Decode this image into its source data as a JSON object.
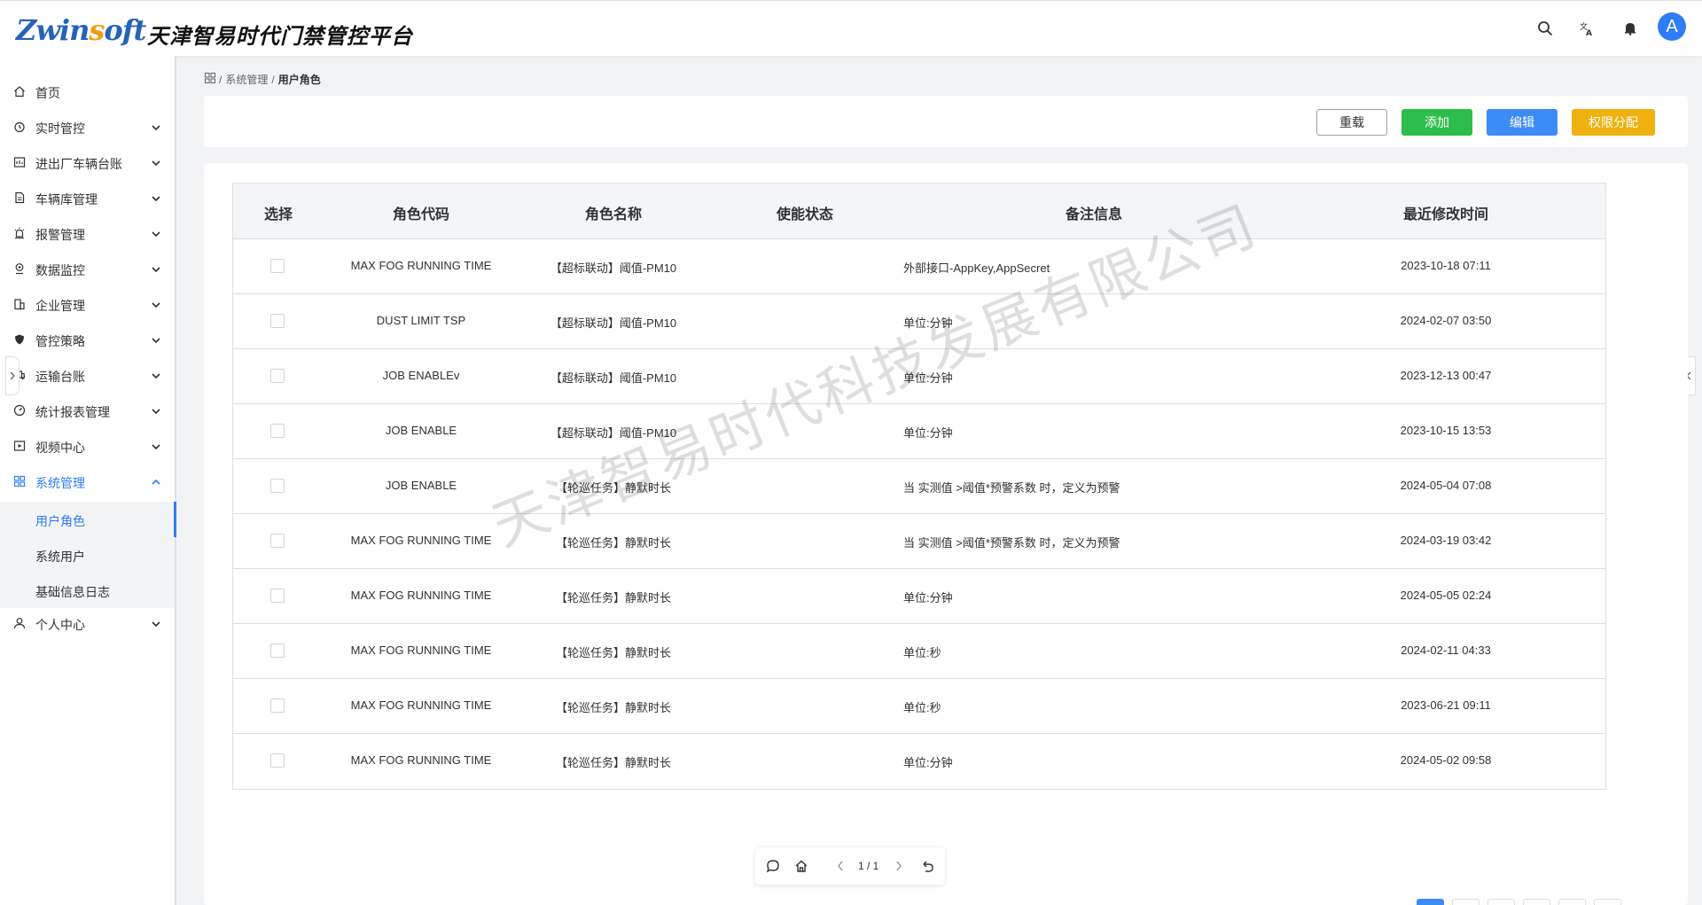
{
  "header": {
    "logo_text": "Zwinsoft",
    "title": "天津智易时代门禁管控平台",
    "avatar_letter": "A",
    "icons": [
      "search-icon",
      "translate-icon",
      "bell-icon"
    ]
  },
  "sidebar": {
    "items": [
      {
        "label": "首页",
        "icon": "home-icon",
        "chevron": false
      },
      {
        "label": "实时管控",
        "icon": "alarm-clock-icon",
        "chevron": true
      },
      {
        "label": "进出厂车辆台账",
        "icon": "ledger-icon",
        "chevron": true
      },
      {
        "label": "车辆库管理",
        "icon": "document-icon",
        "chevron": true
      },
      {
        "label": "报警管理",
        "icon": "siren-icon",
        "chevron": true
      },
      {
        "label": "数据监控",
        "icon": "location-icon",
        "chevron": true
      },
      {
        "label": "企业管理",
        "icon": "building-icon",
        "chevron": true
      },
      {
        "label": "管控策略",
        "icon": "shield-icon",
        "chevron": true
      },
      {
        "label": "运输台账",
        "icon": "truck-icon",
        "chevron": true
      },
      {
        "label": "统计报表管理",
        "icon": "dashboard-icon",
        "chevron": true
      },
      {
        "label": "视频中心",
        "icon": "video-icon",
        "chevron": true
      },
      {
        "label": "系统管理",
        "icon": "grid-icon",
        "chevron": true,
        "expanded": true
      },
      {
        "label": "个人中心",
        "icon": "user-icon",
        "chevron": true
      }
    ],
    "submenu": [
      {
        "label": "用户角色",
        "active": true
      },
      {
        "label": "系统用户",
        "active": false
      },
      {
        "label": "基础信息日志",
        "active": false
      }
    ]
  },
  "breadcrumb": {
    "parent": "系统管理",
    "current": "用户角色"
  },
  "toolbar": {
    "reset_label": "重载",
    "add_label": "添加",
    "edit_label": "编辑",
    "perm_label": "权限分配"
  },
  "table": {
    "headers": [
      "选择",
      "角色代码",
      "角色名称",
      "使能状态",
      "备注信息",
      "最近修改时间"
    ],
    "rows": [
      {
        "code": "MAX FOG RUNNING TIME",
        "name": "【超标联动】阈值-PM10",
        "status": "",
        "note": "外部接口-AppKey,AppSecret",
        "time": "2023-10-18 07:11"
      },
      {
        "code": "DUST LIMIT TSP",
        "name": "【超标联动】阈值-PM10",
        "status": "",
        "note": "单位:分钟",
        "time": "2024-02-07 03:50"
      },
      {
        "code": "JOB ENABLEv",
        "name": "【超标联动】阈值-PM10",
        "status": "",
        "note": "单位:分钟",
        "time": "2023-12-13 00:47"
      },
      {
        "code": "JOB ENABLE",
        "name": "【超标联动】阈值-PM10",
        "status": "",
        "note": "单位:分钟",
        "time": "2023-10-15 13:53"
      },
      {
        "code": "JOB ENABLE",
        "name": "【轮巡任务】静默时长",
        "status": "",
        "note": "当 实测值 >阈值*预警系数 时，定义为预警",
        "time": "2024-05-04 07:08"
      },
      {
        "code": "MAX FOG RUNNING TIME",
        "name": "【轮巡任务】静默时长",
        "status": "",
        "note": "当 实测值 >阈值*预警系数 时，定义为预警",
        "time": "2024-03-19 03:42"
      },
      {
        "code": "MAX FOG RUNNING TIME",
        "name": "【轮巡任务】静默时长",
        "status": "",
        "note": "单位:分钟",
        "time": "2024-05-05 02:24"
      },
      {
        "code": "MAX FOG RUNNING TIME",
        "name": "【轮巡任务】静默时长",
        "status": "",
        "note": "单位:秒",
        "time": "2024-02-11 04:33"
      },
      {
        "code": "MAX FOG RUNNING TIME",
        "name": "【轮巡任务】静默时长",
        "status": "",
        "note": "单位:秒",
        "time": "2023-06-21 09:11"
      },
      {
        "code": "MAX FOG RUNNING TIME",
        "name": "【轮巡任务】静默时长",
        "status": "",
        "note": "单位:分钟",
        "time": "2024-05-02 09:58"
      }
    ]
  },
  "watermark": "天津智易时代科技发展有限公司",
  "pager": {
    "text": "1 / 1"
  },
  "colors": {
    "primary": "#2f7df6",
    "add": "#2dbd4a",
    "edit": "#3d8bf5",
    "perm": "#efb10f"
  }
}
